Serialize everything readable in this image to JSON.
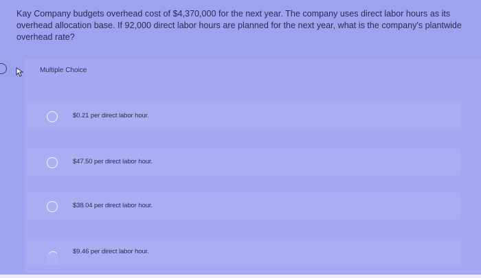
{
  "question": {
    "text": "Kay Company budgets overhead cost of $4,370,000 for the next year. The company uses direct labor hours as its overhead allocation base. If 92,000 direct labor hours are planned for the next year, what is the company's plantwide overhead rate?"
  },
  "answer_panel": {
    "type_label": "Multiple Choice",
    "options": [
      {
        "label": "$0.21 per direct labor hour."
      },
      {
        "label": "$47.50 per direct labor hour."
      },
      {
        "label": "$38.04 per direct labor hour."
      },
      {
        "label": "$9.46 per direct labor hour."
      }
    ]
  },
  "colors": {
    "background": "#9ea3f0",
    "radio": "#f4f5ff",
    "text": "#2a2c52"
  }
}
